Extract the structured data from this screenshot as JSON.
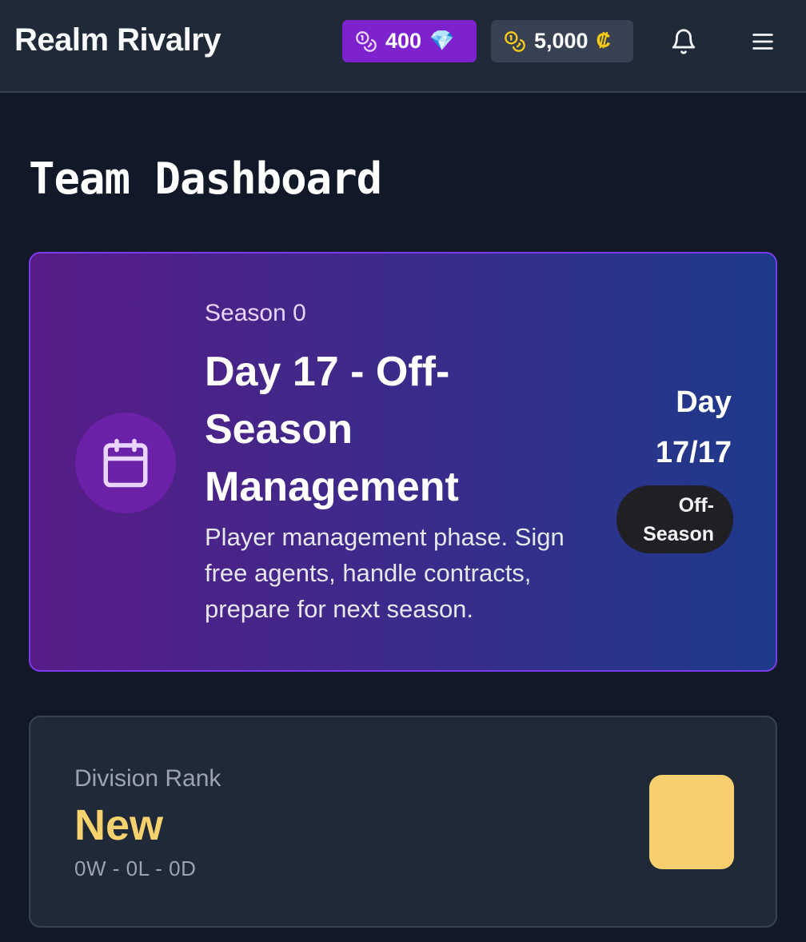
{
  "header": {
    "app_title": "Realm Rivalry",
    "gems": {
      "amount": "400",
      "symbol": "💎",
      "icon": "coins-icon",
      "color": "#7e22ce"
    },
    "credits": {
      "amount": "5,000",
      "symbol": "₡",
      "icon": "coins-icon",
      "color": "#facc15"
    },
    "notifications_icon": "bell-icon",
    "menu_icon": "hamburger-menu-icon"
  },
  "page": {
    "title": "Team Dashboard"
  },
  "season_card": {
    "season_label": "Season 0",
    "headline": "Day 17 - Off-Season Management",
    "description": "Player management phase. Sign free agents, handle contracts, prepare for next season.",
    "day_counter": "Day 17/17",
    "phase_badge": "Off-Season",
    "icon": "calendar-icon",
    "colors": {
      "gradient_start": "#581c87",
      "gradient_end": "#1e3a8a",
      "border": "#7c3aed"
    }
  },
  "rank_card": {
    "label": "Division Rank",
    "value": "New",
    "record": "0W - 0L - 0D",
    "value_color": "#f6d26e"
  }
}
